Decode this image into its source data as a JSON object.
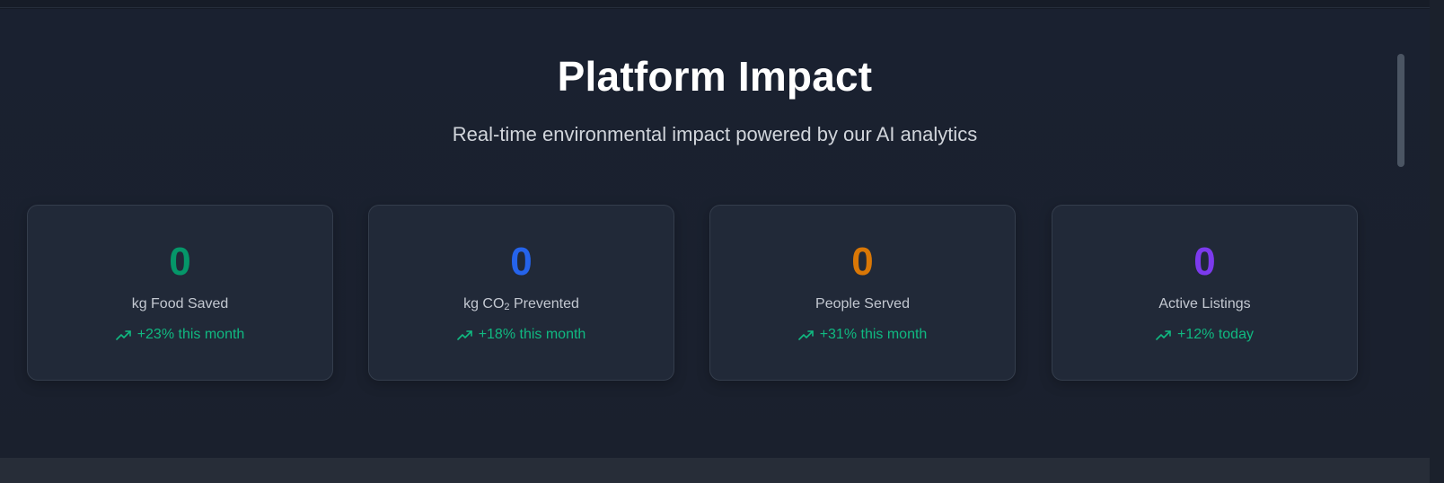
{
  "section": {
    "title": "Platform Impact",
    "subtitle": "Real-time environmental impact powered by our AI analytics"
  },
  "stats": [
    {
      "value": "0",
      "label": "kg Food Saved",
      "label_prefix": "",
      "label_sub": "",
      "label_suffix": "",
      "trend": "+23% this month",
      "color": "#059669",
      "icon": "trending-up-icon"
    },
    {
      "value": "0",
      "label": "kg CO₂ Prevented",
      "label_prefix": "kg CO",
      "label_sub": "2",
      "label_suffix": " Prevented",
      "trend": "+18% this month",
      "color": "#2563eb",
      "icon": "trending-up-icon"
    },
    {
      "value": "0",
      "label": "People Served",
      "label_prefix": "",
      "label_sub": "",
      "label_suffix": "",
      "trend": "+31% this month",
      "color": "#d97706",
      "icon": "trending-up-icon"
    },
    {
      "value": "0",
      "label": "Active Listings",
      "label_prefix": "",
      "label_sub": "",
      "label_suffix": "",
      "trend": "+12% today",
      "color": "#7c3aed",
      "icon": "trending-up-icon"
    }
  ],
  "colors": {
    "background": "#1a2130",
    "card": "#212938",
    "trend": "#10b981"
  }
}
